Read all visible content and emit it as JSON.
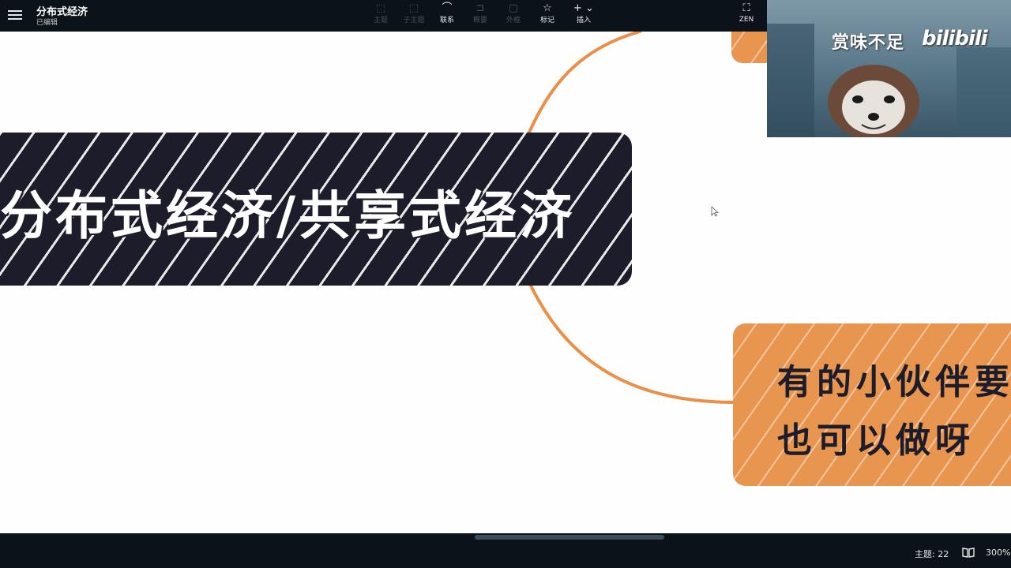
{
  "header": {
    "doc_title": "分布式经济",
    "doc_status": "已编辑",
    "tools": [
      {
        "label": "主题",
        "icon": "topic-icon",
        "glyph": "⬚",
        "enabled": false
      },
      {
        "label": "子主题",
        "icon": "subtopic-icon",
        "glyph": "⬚",
        "enabled": false
      },
      {
        "label": "联系",
        "icon": "relation-icon",
        "glyph": "⌒",
        "enabled": true
      },
      {
        "label": "概要",
        "icon": "summary-icon",
        "glyph": "⊐",
        "enabled": false
      },
      {
        "label": "外框",
        "icon": "boundary-icon",
        "glyph": "▢",
        "enabled": false
      },
      {
        "label": "标记",
        "icon": "star-icon",
        "glyph": "☆",
        "enabled": true
      },
      {
        "label": "插入",
        "icon": "plus-icon",
        "glyph": "+ ⌄",
        "enabled": true
      }
    ],
    "zen": {
      "label": "ZEN",
      "icon": "fullscreen-icon",
      "glyph": "⛶"
    }
  },
  "mindmap": {
    "main_topic": "分布式经济/共享式经济",
    "child_topic": {
      "line1": "有的小伙伴要",
      "line2": "也可以做呀"
    },
    "colors": {
      "main_fill": "#1c1c2b",
      "child_fill": "#e8954f",
      "connector": "#ea8f45"
    }
  },
  "video_overlay": {
    "caption": "赏味不足",
    "logo": "bilibili"
  },
  "statusbar": {
    "topics": "主题: 22",
    "book_icon": "book-icon",
    "zoom": "300%"
  }
}
